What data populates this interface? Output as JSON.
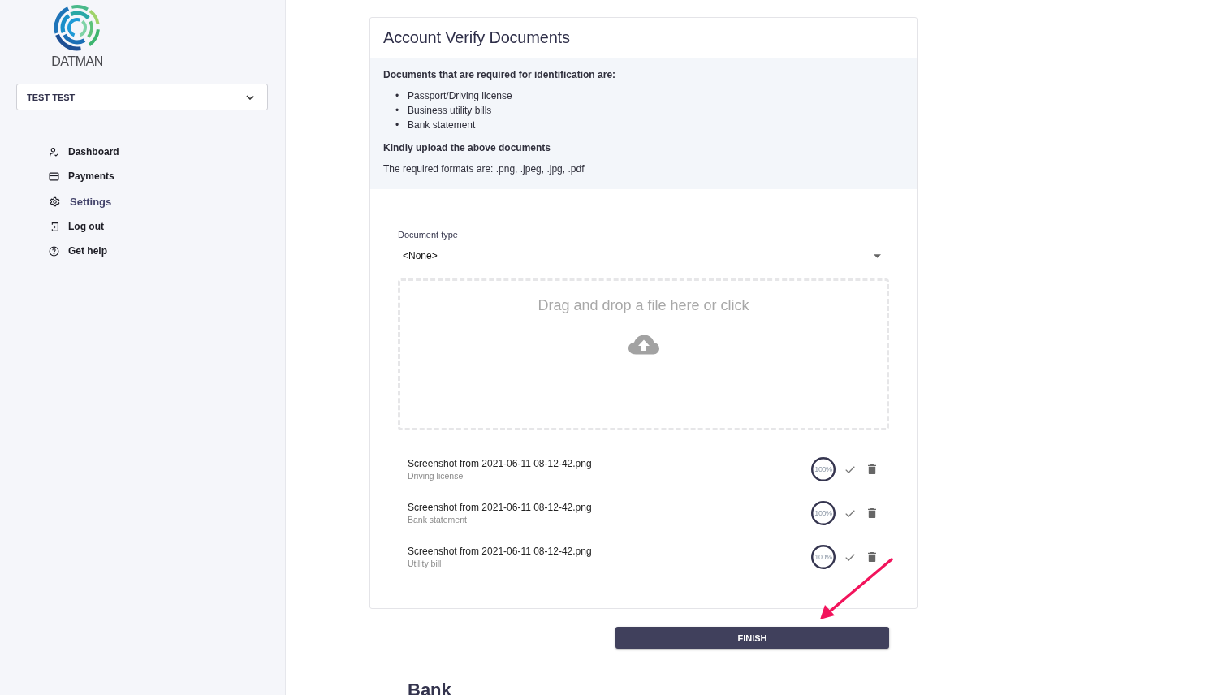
{
  "sidebar": {
    "logo_text": "DATMAN",
    "account_select": {
      "value": "TEST TEST"
    },
    "items": [
      {
        "label": "Dashboard",
        "selected": false
      },
      {
        "label": "Payments",
        "selected": false
      },
      {
        "label": "Settings",
        "selected": true
      },
      {
        "label": "Log out",
        "selected": false
      },
      {
        "label": "Get help",
        "selected": false
      }
    ]
  },
  "card": {
    "title": "Account Verify Documents",
    "info": {
      "heading": "Documents that are required for identification are:",
      "required_documents": [
        {
          "marker": "•",
          "text": "Passport/Driving license"
        },
        {
          "marker": "•",
          "text": "Business utility bills"
        },
        {
          "marker": "•",
          "text": "Bank statement"
        }
      ],
      "instruction": "Kindly upload the above documents",
      "formats": "The required formats are: .png, .jpeg, .jpg, .pdf"
    },
    "document_type": {
      "label": "Document type",
      "value": "<None>"
    },
    "dropzone": {
      "text": "Drag and drop a file here or click"
    },
    "files": [
      {
        "name": "Screenshot from 2021-06-11 08-12-42.png",
        "type": "Driving license",
        "progress": "100%",
        "level": 1,
        "uploaded": true
      },
      {
        "name": "Screenshot from 2021-06-11 08-12-42.png",
        "type": "Bank statement",
        "progress": "100%",
        "level": 1,
        "uploaded": true
      },
      {
        "name": "Screenshot from 2021-06-11 08-12-42.png",
        "type": "Utility bill",
        "progress": "100%",
        "level": 1,
        "uploaded": true
      }
    ]
  },
  "finish_button": "FINISH",
  "next_section": {
    "title": "Bank"
  }
}
